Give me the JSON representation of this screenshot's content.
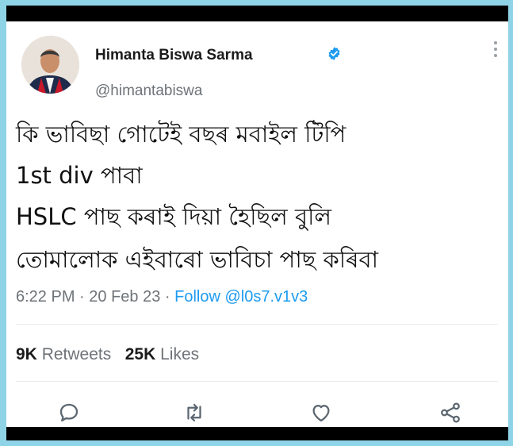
{
  "tweet": {
    "author_name": "Himanta Biswa Sarma",
    "handle": "@himantabiswa",
    "lines": [
      "কি ভাবিছা গোটেই বছৰ মবাইল টিপি",
      "1st div পাবা",
      "HSLC পাছ কৰাই দিয়া হৈছিল বুলি",
      "তোমালোক এইবাৰো ভাবিচা পাছ কৰিবা"
    ],
    "time": "6:22 PM",
    "dot": " · ",
    "date": "20 Feb 23",
    "dot2": " · ",
    "follow_text": "Follow @l0s7.v1v3",
    "retweets_count": "9K",
    "retweets_label": " Retweets",
    "likes_count": "25K",
    "likes_label": " Likes"
  },
  "icons": {
    "verified": "verified-badge-icon",
    "more": "more-vertical-icon",
    "reply": "reply-icon",
    "retweet": "retweet-icon",
    "like": "heart-icon",
    "share": "share-icon"
  },
  "colors": {
    "accent": "#1d9bf0",
    "frame": "#8fd3e6"
  }
}
